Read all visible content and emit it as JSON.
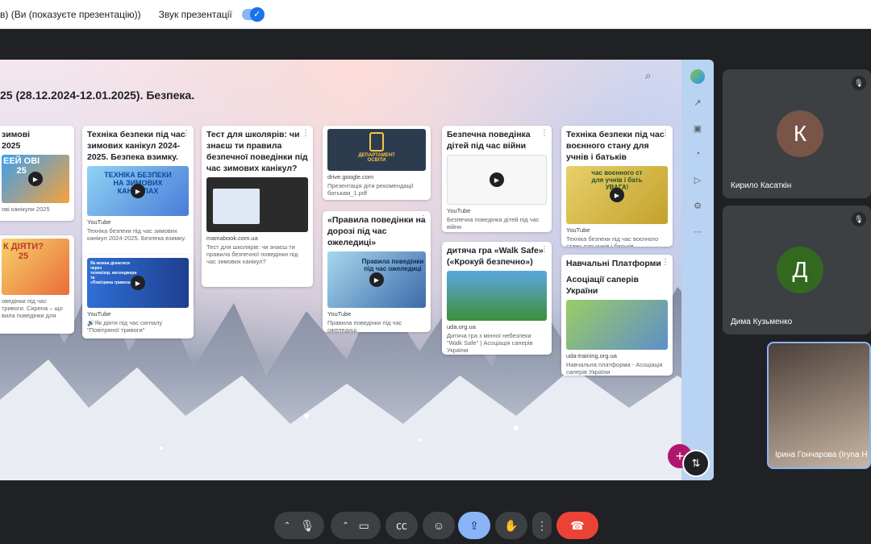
{
  "topbar": {
    "presentation_title": "в) (Ви (показуєте презентацію))",
    "sound_label": "Звук презентації",
    "sound_toggle_on": true
  },
  "slide": {
    "title": "25 (28.12.2024-12.01.2025). Безпека.",
    "cards": [
      {
        "title": "зимові\n2025",
        "thumb_text": "ЕЕЙ ОВІ\n25",
        "desc": "ові канікули 2025"
      },
      {
        "title": "",
        "thumb_text": "К ДІЯТИ?\n25",
        "desc": "оведінки під час\nтривоги. Сирена – що\nвила поведінки для"
      },
      {
        "title": "Техніка безпеки під час зимових канікул 2024-2025. Безпека взимку.",
        "thumb_text": "ТЕХНІКА БЕЗПЕКИ\nНА ЗИМОВИХ\nКАНІКУЛАХ",
        "source": "YouTube",
        "desc": "Техніка безпеки під час зимових канікул 2024-2025. Безпека взимку."
      },
      {
        "title": "",
        "thumb_text": "Як можна дізнатися через\nтелевізор, месенджери та\n«Повітряна тривога»",
        "source": "YouTube",
        "desc": "🔊Як діяти під час сигналу \"Повітряної тривоги\""
      },
      {
        "title": "Тест для школярів: чи знаєш ти правила безпечної поведінки під час зимових канікул?",
        "source": "mamabook.com.ua",
        "desc": "Тест для школярів: чи знаєш ти правила безпечної поведінки під час зимових канікул?"
      },
      {
        "title": "",
        "thumb_text": "ДЕПАРТАМЕНТ\nОСВІТИ",
        "source": "drive.google.com",
        "desc": "Презентація діти рекомендації батькам_1.pdf"
      },
      {
        "title": "«Правила поведінки на дорозі під час ожеледиці»",
        "thumb_text": "Правила поведінки\nпід час ожеледиці",
        "source": "YouTube",
        "desc": "Правила поведінки під час ожеледиці."
      },
      {
        "title": "Безпечна поведінка дітей під час війни",
        "source": "YouTube",
        "desc": "Безпечна поведінка дітей під час війни"
      },
      {
        "title": "дитяча гра «Walk Safe» («Крокуй безпечно»)",
        "source": "uda.org.ua",
        "desc": "Дитяча гра з мінної небезпеки \"Walk Safe\" | Асоціація саперів України"
      },
      {
        "title": "Техніка безпеки під час воєнного стану для учнів і батьків",
        "thumb_text": "час воєнного ст\nдля учнів і бать\nУВАГА!",
        "source": "YouTube",
        "desc": "Техніка безпеки під час воєнного стану для учнів і батьків"
      },
      {
        "title": "Навчальні Платформи",
        "subtitle": "Асоціації саперів України",
        "source": "uda-training.org.ua",
        "desc": "Навчальна платформа - Асоціація саперів України"
      }
    ]
  },
  "participants": [
    {
      "name": "Кирило Касаткін",
      "initial": "К",
      "color": "#795548"
    },
    {
      "name": "Дима Кузьменко",
      "initial": "Д",
      "color": "#33691e"
    },
    {
      "name": "Ірина Гончарова (Iryna H"
    }
  ],
  "controls": {
    "mic_icon": "mic-icon",
    "camera_icon": "camera-icon",
    "captions_icon": "captions-icon",
    "emoji_icon": "emoji-icon",
    "present_icon": "present-icon",
    "hand_icon": "hand-icon",
    "more_icon": "more-vert-icon",
    "hangup_icon": "hangup-icon",
    "hangup_color": "#ea4335",
    "present_color": "#8ab4f8"
  }
}
